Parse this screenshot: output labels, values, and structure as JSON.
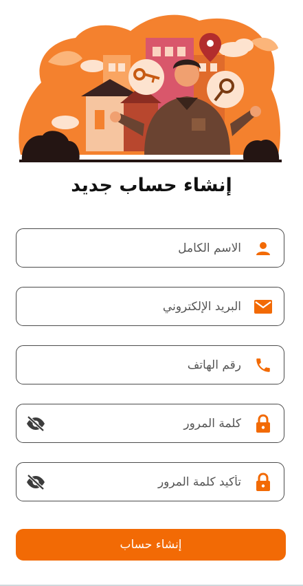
{
  "page": {
    "title": "إنشاء حساب جديد"
  },
  "form": {
    "fields": [
      {
        "placeholder": "الاسم الكامل",
        "icon": "person-icon",
        "value": ""
      },
      {
        "placeholder": "البريد الإلكتروني",
        "icon": "email-icon",
        "value": ""
      },
      {
        "placeholder": "رقم الهاتف",
        "icon": "phone-icon",
        "value": ""
      },
      {
        "placeholder": "كلمة المرور",
        "icon": "lock-icon",
        "toggle_icon": "eye-off-icon",
        "value": ""
      },
      {
        "placeholder": "تأكيد كلمة المرور",
        "icon": "lock-icon",
        "toggle_icon": "eye-off-icon",
        "value": ""
      }
    ],
    "submit_label": "إنشاء حساب"
  },
  "colors": {
    "accent": "#f26a05",
    "border": "#4a4a4a",
    "text": "#111111"
  }
}
